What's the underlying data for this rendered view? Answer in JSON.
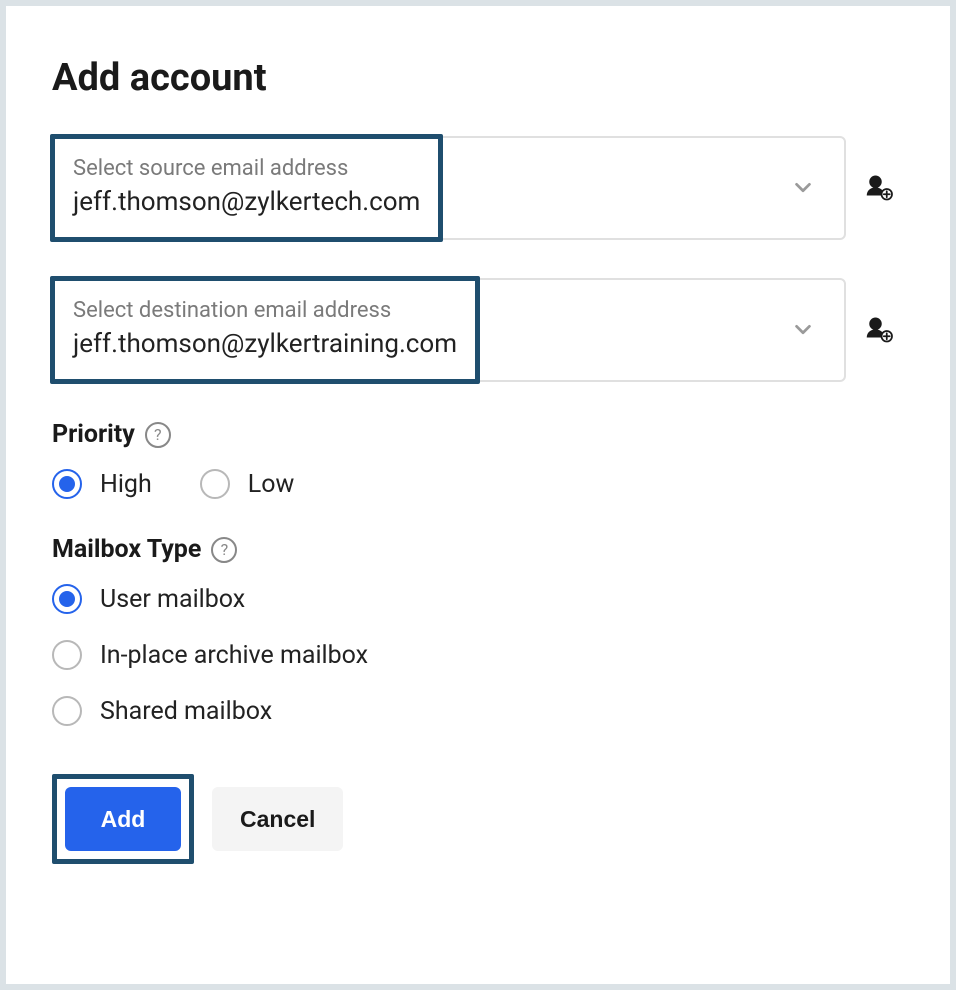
{
  "title": "Add account",
  "source": {
    "label": "Select source email address",
    "value": "jeff.thomson@zylkertech.com"
  },
  "destination": {
    "label": "Select destination email address",
    "value": "jeff.thomson@zylkertraining.com"
  },
  "priority": {
    "label": "Priority",
    "options": {
      "high": "High",
      "low": "Low"
    },
    "selected": "high"
  },
  "mailbox_type": {
    "label": "Mailbox Type",
    "options": {
      "user": "User mailbox",
      "archive": "In-place archive mailbox",
      "shared": "Shared mailbox"
    },
    "selected": "user"
  },
  "buttons": {
    "add": "Add",
    "cancel": "Cancel"
  },
  "help_glyph": "?"
}
